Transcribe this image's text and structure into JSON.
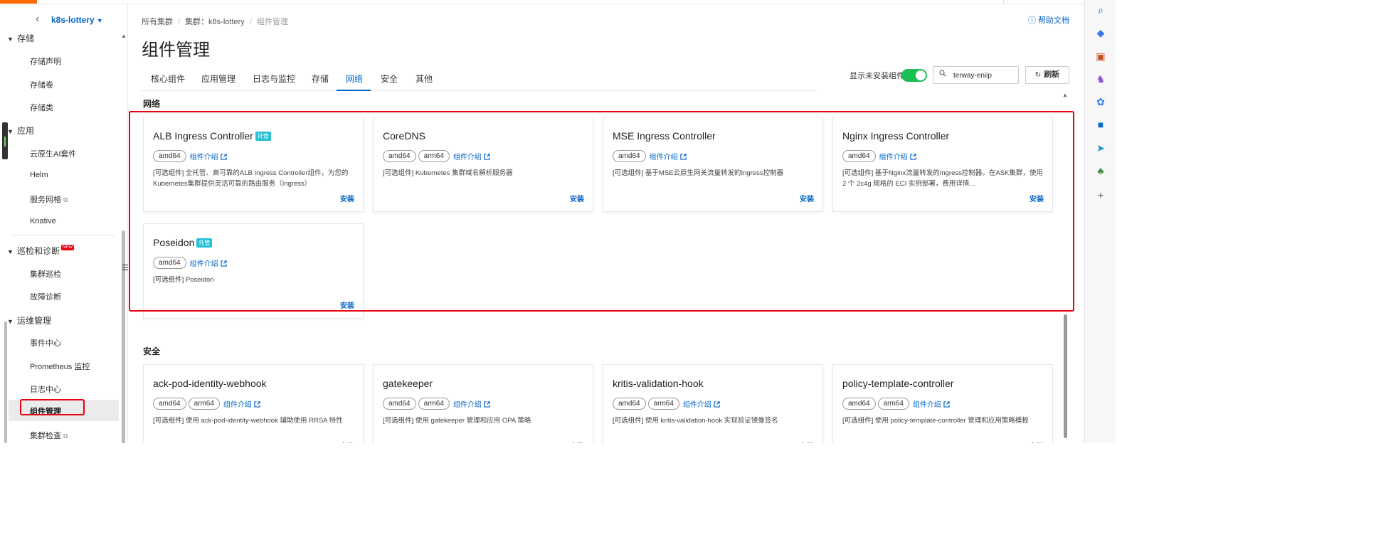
{
  "sidebar": {
    "cluster_name": "k8s-lottery",
    "groups": [
      {
        "label": "存储",
        "items": [
          "存储声明",
          "存储卷",
          "存储类"
        ]
      },
      {
        "label": "应用",
        "items": [
          "云原生AI套件",
          "Helm",
          "服务网格",
          "Knative"
        ]
      },
      {
        "label": "巡检和诊断",
        "badge": "NEW",
        "items": [
          "集群巡检",
          "故障诊断"
        ]
      },
      {
        "label": "运维管理",
        "items": [
          "事件中心",
          "Prometheus 监控",
          "日志中心",
          "组件管理",
          "集群检查"
        ]
      }
    ]
  },
  "header": {
    "breadcrumb": [
      "所有集群",
      "集群：k8s-lottery",
      "组件管理"
    ],
    "help_label": "帮助文档",
    "title": "组件管理"
  },
  "tabs": [
    "核心组件",
    "应用管理",
    "日志与监控",
    "存储",
    "网络",
    "安全",
    "其他"
  ],
  "active_tab": "网络",
  "toolbar": {
    "toggle_label": "显示未安装组件",
    "toggle_on": true,
    "search_value": "terway-eniip",
    "refresh_label": "刷新"
  },
  "sections": [
    {
      "title": "网络",
      "cards": [
        {
          "name": "ALB Ingress Controller",
          "managed": "托管",
          "arch": [
            "amd64"
          ],
          "intro": "组件介绍",
          "prefix": "[可选组件]",
          "desc": "全托管、高可靠的ALB Ingress Controller组件，为您的Kubernetes集群提供灵活可靠的路由服务（Ingress）",
          "action": "安装"
        },
        {
          "name": "CoreDNS",
          "arch": [
            "amd64",
            "arm64"
          ],
          "intro": "组件介绍",
          "prefix": "[可选组件]",
          "desc": "Kubernetes 集群域名解析服务器",
          "action": "安装"
        },
        {
          "name": "MSE Ingress Controller",
          "arch": [
            "amd64"
          ],
          "intro": "组件介绍",
          "prefix": "[可选组件]",
          "desc": "基于MSE云原生网关流量转发的Ingress控制器",
          "action": "安装"
        },
        {
          "name": "Nginx Ingress Controller",
          "arch": [
            "amd64"
          ],
          "intro": "组件介绍",
          "prefix": "[可选组件]",
          "desc": "基于Nginx流量转发的Ingress控制器。在ASK集群，使用 2 个 2c4g 规格的 ECI 实例部署，费用详情...",
          "action": "安装"
        },
        {
          "name": "Poseidon",
          "managed": "托管",
          "arch": [
            "amd64"
          ],
          "intro": "组件介绍",
          "prefix": "[可选组件]",
          "desc": "Poseidon",
          "action": "安装"
        }
      ]
    },
    {
      "title": "安全",
      "cards": [
        {
          "name": "ack-pod-identity-webhook",
          "arch": [
            "amd64",
            "arm64"
          ],
          "intro": "组件介绍",
          "prefix": "[可选组件]",
          "desc": "使用 ack-pod-identity-webhook 辅助使用 RRSA 特性",
          "action": "安装"
        },
        {
          "name": "gatekeeper",
          "arch": [
            "amd64",
            "arm64"
          ],
          "intro": "组件介绍",
          "prefix": "[可选组件]",
          "desc": "使用 gatekeeper 管理和应用 OPA 策略",
          "action": "安装"
        },
        {
          "name": "kritis-validation-hook",
          "arch": [
            "amd64",
            "arm64"
          ],
          "intro": "组件介绍",
          "prefix": "[可选组件]",
          "desc": "使用 kritis-validation-hook 实现验证镜像签名",
          "action": "安装"
        },
        {
          "name": "policy-template-controller",
          "arch": [
            "amd64",
            "arm64"
          ],
          "intro": "组件介绍",
          "prefix": "[可选组件]",
          "desc": "使用 policy-template-controller 管理和应用策略模板",
          "action": "安装"
        }
      ]
    }
  ],
  "rail_icons": [
    "search-icon",
    "tag-icon",
    "briefcase-icon",
    "chess-icon",
    "gear-app-icon",
    "outlook-icon",
    "send-icon",
    "tree-icon",
    "plus-icon"
  ],
  "colors": {
    "accent": "#0064c8",
    "highlight": "#e60012",
    "toggle": "#1bbf54",
    "managed_badge": "#21c1d6",
    "brand": "#ff6a00"
  }
}
